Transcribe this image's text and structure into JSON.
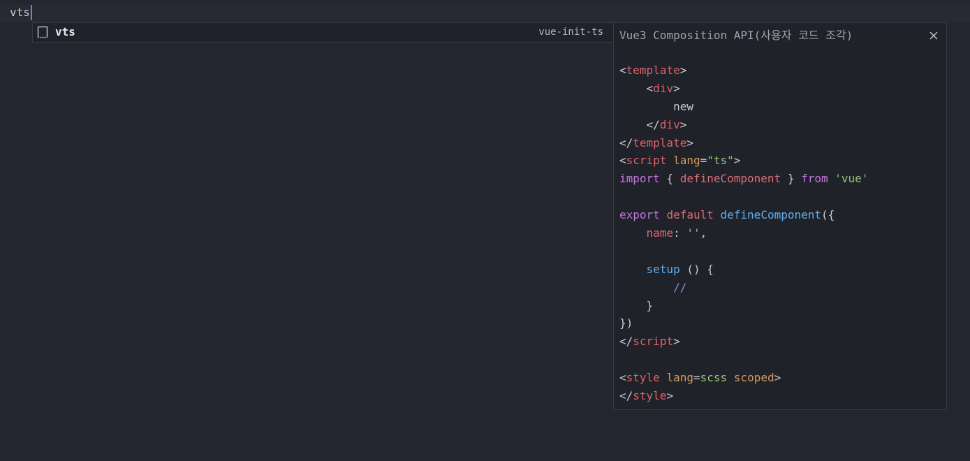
{
  "editor": {
    "typed_text": "vts"
  },
  "suggest": {
    "items": [
      {
        "label": "vts",
        "detail": "vue-init-ts",
        "icon": "snippet-icon"
      }
    ]
  },
  "details": {
    "title": "Vue3 Composition API(사용자 코드 조각)",
    "close_icon": "close-icon",
    "code_lines": [
      [
        {
          "t": "<",
          "c": "punc"
        },
        {
          "t": "template",
          "c": "tag"
        },
        {
          "t": ">",
          "c": "punc"
        }
      ],
      [
        {
          "t": "    <",
          "c": "punc"
        },
        {
          "t": "div",
          "c": "tag"
        },
        {
          "t": ">",
          "c": "punc"
        }
      ],
      [
        {
          "t": "        new",
          "c": "plain"
        }
      ],
      [
        {
          "t": "    </",
          "c": "punc"
        },
        {
          "t": "div",
          "c": "tag"
        },
        {
          "t": ">",
          "c": "punc"
        }
      ],
      [
        {
          "t": "</",
          "c": "punc"
        },
        {
          "t": "template",
          "c": "tag"
        },
        {
          "t": ">",
          "c": "punc"
        }
      ],
      [
        {
          "t": "<",
          "c": "punc"
        },
        {
          "t": "script",
          "c": "tag"
        },
        {
          "t": " ",
          "c": "plain"
        },
        {
          "t": "lang",
          "c": "attr"
        },
        {
          "t": "=",
          "c": "punc"
        },
        {
          "t": "\"ts\"",
          "c": "str"
        },
        {
          "t": ">",
          "c": "punc"
        }
      ],
      [
        {
          "t": "import",
          "c": "kw"
        },
        {
          "t": " { ",
          "c": "punc"
        },
        {
          "t": "defineComponent",
          "c": "var"
        },
        {
          "t": " } ",
          "c": "punc"
        },
        {
          "t": "from",
          "c": "kw"
        },
        {
          "t": " ",
          "c": "plain"
        },
        {
          "t": "'vue'",
          "c": "str"
        }
      ],
      [],
      [
        {
          "t": "export",
          "c": "kw"
        },
        {
          "t": " ",
          "c": "plain"
        },
        {
          "t": "default",
          "c": "var"
        },
        {
          "t": " ",
          "c": "plain"
        },
        {
          "t": "defineComponent",
          "c": "fn"
        },
        {
          "t": "({",
          "c": "punc"
        }
      ],
      [
        {
          "t": "    ",
          "c": "plain"
        },
        {
          "t": "name",
          "c": "var"
        },
        {
          "t": ": ",
          "c": "punc"
        },
        {
          "t": "''",
          "c": "str"
        },
        {
          "t": ",",
          "c": "punc"
        }
      ],
      [],
      [
        {
          "t": "    ",
          "c": "plain"
        },
        {
          "t": "setup",
          "c": "fn"
        },
        {
          "t": " () {",
          "c": "punc"
        }
      ],
      [
        {
          "t": "        //",
          "c": "comment"
        }
      ],
      [
        {
          "t": "    }",
          "c": "punc"
        }
      ],
      [
        {
          "t": "})",
          "c": "punc"
        }
      ],
      [
        {
          "t": "</",
          "c": "punc"
        },
        {
          "t": "script",
          "c": "tag"
        },
        {
          "t": ">",
          "c": "punc"
        }
      ],
      [],
      [
        {
          "t": "<",
          "c": "punc"
        },
        {
          "t": "style",
          "c": "tag"
        },
        {
          "t": " ",
          "c": "plain"
        },
        {
          "t": "lang",
          "c": "attr"
        },
        {
          "t": "=",
          "c": "punc"
        },
        {
          "t": "scss",
          "c": "str"
        },
        {
          "t": " ",
          "c": "plain"
        },
        {
          "t": "scoped",
          "c": "attr"
        },
        {
          "t": ">",
          "c": "punc"
        }
      ],
      [
        {
          "t": "</",
          "c": "punc"
        },
        {
          "t": "style",
          "c": "tag"
        },
        {
          "t": ">",
          "c": "punc"
        }
      ]
    ]
  },
  "colors": {
    "background": "#23262f",
    "widget_background": "#1f2229",
    "cursor": "#528bff",
    "tag": "#e0616b",
    "attribute": "#d49a5e",
    "string": "#98c379",
    "keyword": "#c678dd",
    "function": "#61afef"
  }
}
